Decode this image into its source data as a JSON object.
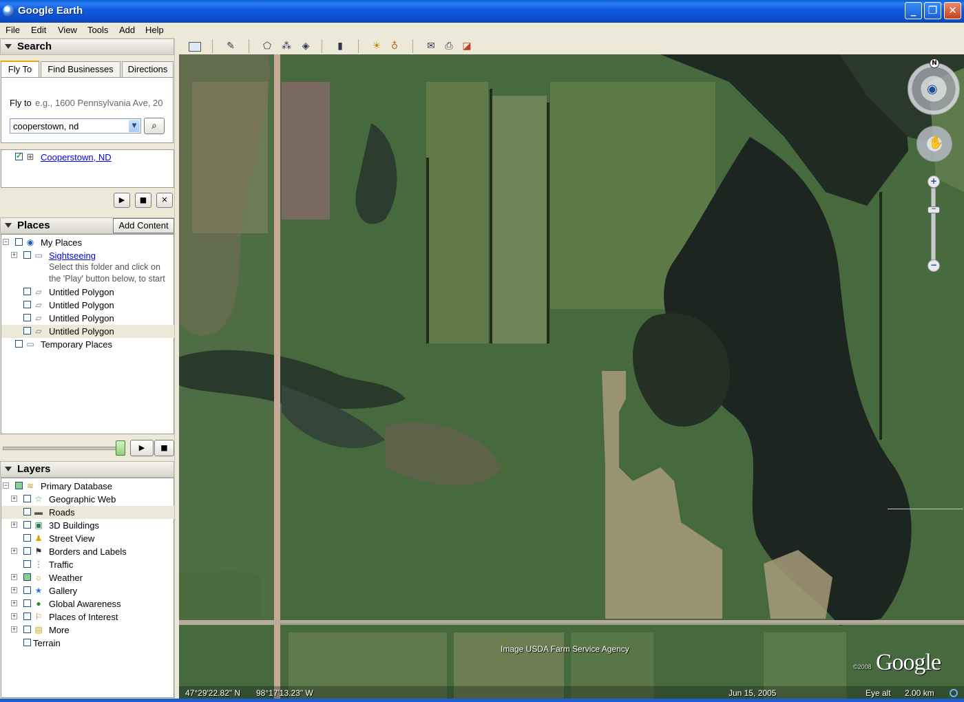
{
  "window": {
    "title": "Google Earth",
    "minimize": "_",
    "maximize": "❐",
    "close": "✕"
  },
  "menu": [
    "File",
    "Edit",
    "View",
    "Tools",
    "Add",
    "Help"
  ],
  "search": {
    "header": "Search",
    "tabs": [
      "Fly To",
      "Find Businesses",
      "Directions"
    ],
    "fly_to_label": "Fly to",
    "fly_to_hint": "e.g., 1600 Pennsylvania Ave, 20",
    "query_value": "cooperstown, nd",
    "search_icon": "magnifier-icon",
    "result": "Cooperstown, ND",
    "controls": [
      "play-icon",
      "stop-icon",
      "close-icon"
    ]
  },
  "places": {
    "header": "Places",
    "add_content": "Add Content",
    "items": [
      {
        "label": "My Places",
        "icon": "globe-icon"
      },
      {
        "label": "Sightseeing",
        "icon": "folder-icon",
        "link": true
      },
      {
        "label": "Select this folder and click on",
        "note": true
      },
      {
        "label": "the 'Play' button below, to start",
        "note": true
      },
      {
        "label": "Untitled Polygon",
        "icon": "polygon-icon"
      },
      {
        "label": "Untitled Polygon",
        "icon": "polygon-icon"
      },
      {
        "label": "Untitled Polygon",
        "icon": "polygon-icon"
      },
      {
        "label": "Untitled Polygon",
        "icon": "polygon-icon",
        "selected": true
      },
      {
        "label": "Temporary Places",
        "icon": "folder-icon"
      }
    ]
  },
  "layers": {
    "header": "Layers",
    "items": [
      {
        "label": "Primary Database",
        "icon": "database-icon"
      },
      {
        "label": "Geographic Web",
        "icon": "star-icon"
      },
      {
        "label": "Roads",
        "icon": "road-icon",
        "selected": true
      },
      {
        "label": "3D Buildings",
        "icon": "building-icon"
      },
      {
        "label": "Street View",
        "icon": "person-icon"
      },
      {
        "label": "Borders and Labels",
        "icon": "flag-icon"
      },
      {
        "label": "Traffic",
        "icon": "traffic-light-icon"
      },
      {
        "label": "Weather",
        "icon": "sun-icon"
      },
      {
        "label": "Gallery",
        "icon": "gallery-star-icon"
      },
      {
        "label": "Global Awareness",
        "icon": "earth-icon"
      },
      {
        "label": "Places of Interest",
        "icon": "pin-icon"
      },
      {
        "label": "More",
        "icon": "note-icon"
      },
      {
        "label": "Terrain",
        "icon": ""
      }
    ]
  },
  "toolbar": [
    "sidebar-toggle-icon",
    "placemark-icon",
    "polygon-tool-icon",
    "path-tool-icon",
    "overlay-icon",
    "ruler-icon",
    "sunlight-icon",
    "sky-icon",
    "email-icon",
    "print-icon",
    "google-maps-icon"
  ],
  "nav": {
    "north": "N",
    "zoom_in": "+",
    "zoom_out": "−",
    "zoom_level": 0.75
  },
  "map": {
    "credit": "Image USDA Farm Service Agency",
    "logo": "Google",
    "copyright": "©2008",
    "lat": "47°29'22.82\" N",
    "lon": "98°17'13.23\" W",
    "date": "Jun 15, 2005",
    "eye_alt_label": "Eye alt",
    "eye_alt_value": "2.00 km"
  },
  "colors": {
    "titlebar": "#0b55d4",
    "panel_bg": "#ece9d8",
    "link": "#0000ee",
    "tab_active": "#f0a30a"
  }
}
